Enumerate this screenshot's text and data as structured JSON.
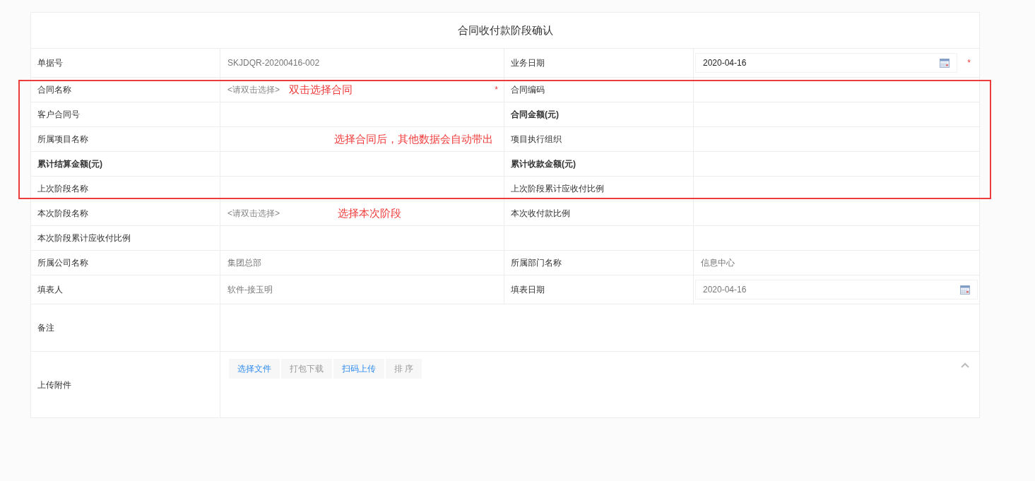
{
  "title": "合同收付款阶段确认",
  "rows": [
    {
      "highlighted": false,
      "cells": [
        {
          "kind": "label",
          "text": "单据号",
          "bold": false
        },
        {
          "kind": "text",
          "text": "SKJDQR-20200416-002"
        },
        {
          "kind": "label",
          "text": "业务日期",
          "bold": false
        },
        {
          "kind": "date",
          "value": "2020-04-16",
          "required_mark": "*",
          "disabled": false
        }
      ]
    },
    {
      "highlighted": true,
      "cells": [
        {
          "kind": "label",
          "text": "合同名称",
          "bold": false
        },
        {
          "kind": "pick",
          "placeholder": "<请双击选择>",
          "required_mark": "*",
          "note": "双击选择合同"
        },
        {
          "kind": "label",
          "text": "合同编码",
          "bold": false
        },
        {
          "kind": "empty"
        }
      ]
    },
    {
      "highlighted": true,
      "cells": [
        {
          "kind": "label",
          "text": "客户合同号",
          "bold": false
        },
        {
          "kind": "empty"
        },
        {
          "kind": "label",
          "text": "合同金额(元)",
          "bold": true
        },
        {
          "kind": "empty"
        }
      ]
    },
    {
      "highlighted": true,
      "cells": [
        {
          "kind": "label",
          "text": "所属项目名称",
          "bold": false
        },
        {
          "kind": "empty",
          "note": "选择合同后，其他数据会自动带出"
        },
        {
          "kind": "label",
          "text": "项目执行组织",
          "bold": false
        },
        {
          "kind": "empty"
        }
      ]
    },
    {
      "highlighted": true,
      "cells": [
        {
          "kind": "label",
          "text": "累计结算金额(元)",
          "bold": true
        },
        {
          "kind": "empty"
        },
        {
          "kind": "label",
          "text": "累计收款金额(元)",
          "bold": true
        },
        {
          "kind": "empty"
        }
      ]
    },
    {
      "highlighted": true,
      "cells": [
        {
          "kind": "label",
          "text": "上次阶段名称",
          "bold": false
        },
        {
          "kind": "empty"
        },
        {
          "kind": "label",
          "text": "上次阶段累计应收付比例",
          "bold": false
        },
        {
          "kind": "empty"
        }
      ]
    },
    {
      "highlighted": false,
      "cells": [
        {
          "kind": "label",
          "text": "本次阶段名称",
          "bold": false
        },
        {
          "kind": "pick",
          "placeholder": "<请双击选择>",
          "note": "选择本次阶段"
        },
        {
          "kind": "label",
          "text": "本次收付款比例",
          "bold": false
        },
        {
          "kind": "empty"
        }
      ]
    },
    {
      "highlighted": false,
      "cells": [
        {
          "kind": "label",
          "text": "本次阶段累计应收付比例",
          "bold": false
        },
        {
          "kind": "empty"
        },
        {
          "kind": "empty"
        },
        {
          "kind": "empty"
        }
      ]
    },
    {
      "highlighted": false,
      "cells": [
        {
          "kind": "label",
          "text": "所属公司名称",
          "bold": false
        },
        {
          "kind": "text",
          "text": "集团总部"
        },
        {
          "kind": "label",
          "text": "所属部门名称",
          "bold": false
        },
        {
          "kind": "text",
          "text": "信息中心"
        }
      ]
    },
    {
      "highlighted": false,
      "cells": [
        {
          "kind": "label",
          "text": "填表人",
          "bold": false
        },
        {
          "kind": "text",
          "text": "软件-接玉明"
        },
        {
          "kind": "label",
          "text": "填表日期",
          "bold": false
        },
        {
          "kind": "date",
          "value": "2020-04-16",
          "disabled": true
        }
      ]
    }
  ],
  "remarks": {
    "label": "备注"
  },
  "attachments": {
    "label": "上传附件",
    "buttons": [
      {
        "label": "选择文件",
        "disabled": false
      },
      {
        "label": "打包下载",
        "disabled": true
      },
      {
        "label": "扫码上传",
        "disabled": false
      },
      {
        "label": "排 序",
        "disabled": true
      }
    ]
  }
}
